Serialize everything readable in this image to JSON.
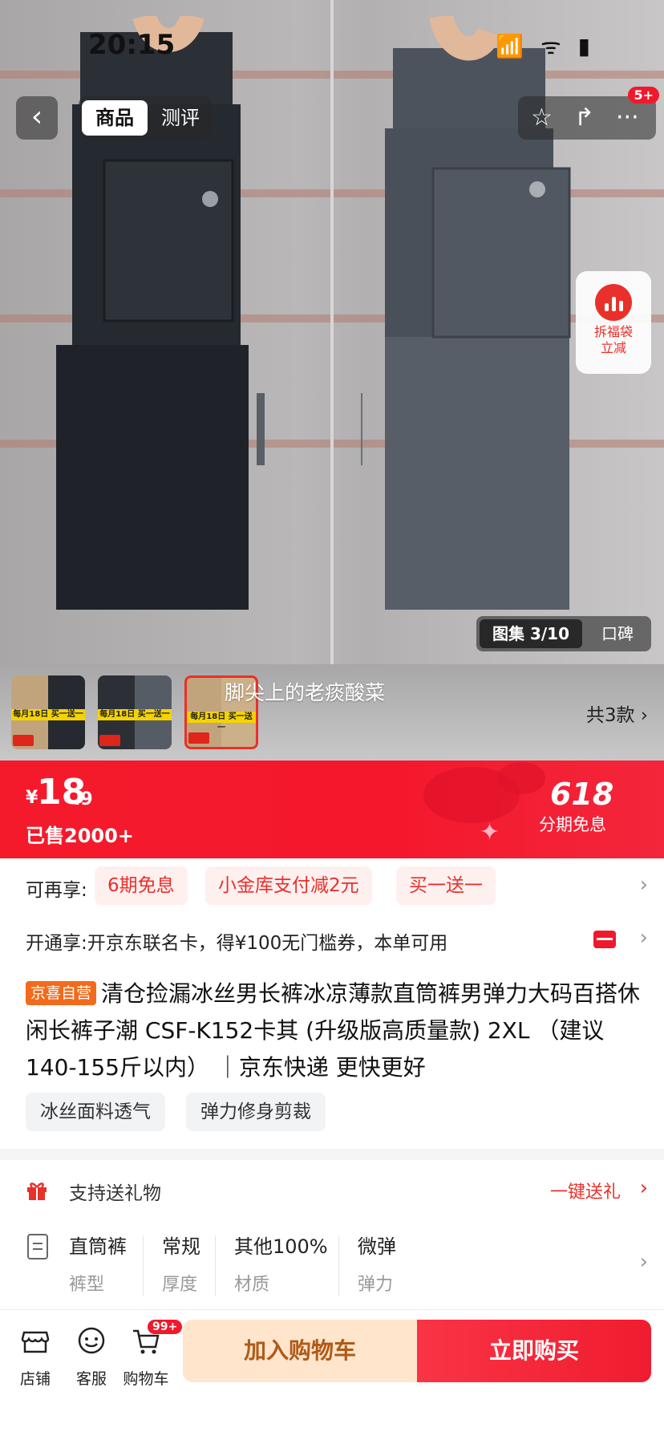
{
  "status_bar": {
    "time": "20:15",
    "icons": "📶 ᯤ ▮"
  },
  "top_nav": {
    "back_icon": "‹",
    "tabs": [
      "商品",
      "测评"
    ],
    "actions": {
      "star_icon": "☆",
      "share_icon": "↱",
      "more_icon": "···",
      "more_badge": "5+"
    }
  },
  "float_card": {
    "line1": "拆福袋",
    "line2": "立减"
  },
  "gallery": {
    "counter": "图集 3/10",
    "review_tab": "口碑"
  },
  "thumbs": {
    "tag_text": "每月18日 买一送一",
    "caption": "脚尖上的老痰酸菜",
    "style_count": "共3款 ›"
  },
  "price": {
    "currency": "¥",
    "integer": "18",
    "decimal": ".9",
    "sold": "已售2000+",
    "promo_number": "618",
    "promo_label": "分期免息"
  },
  "promo_row": {
    "label": "可再享:",
    "pills": [
      "6期免息",
      "小金库支付减2元",
      "买一送一"
    ]
  },
  "card_row": {
    "text": "开通享:开京东联名卡，得¥100无门槛券，本单可用"
  },
  "title": {
    "tag": "京喜自营",
    "text": "清仓捡漏冰丝男长裤冰凉薄款直筒裤男弹力大码百搭休闲长裤子潮 CSF-K152卡其 (升级版高质量款) 2XL （建议140-155斤以内） ｜京东快递 更快更好"
  },
  "features": [
    "冰丝面料透气",
    "弹力修身剪裁"
  ],
  "gift_row": {
    "label": "支持送礼物",
    "action": "一键送礼"
  },
  "specs": [
    {
      "value": "直筒裤",
      "key": "裤型"
    },
    {
      "value": "常规",
      "key": "厚度"
    },
    {
      "value": "其他100%",
      "key": "材质"
    },
    {
      "value": "微弹",
      "key": "弹力"
    }
  ],
  "bottom_bar": {
    "store": "店铺",
    "service": "客服",
    "cart": "购物车",
    "cart_badge": "99+",
    "add_cart": "加入购物车",
    "buy_now": "立即购买"
  },
  "colors": {
    "brand_red": "#f0192c",
    "jx_orange": "#f26a1b",
    "cart_btn_bg": "#ffe5cc",
    "cart_btn_text": "#b05a18"
  }
}
